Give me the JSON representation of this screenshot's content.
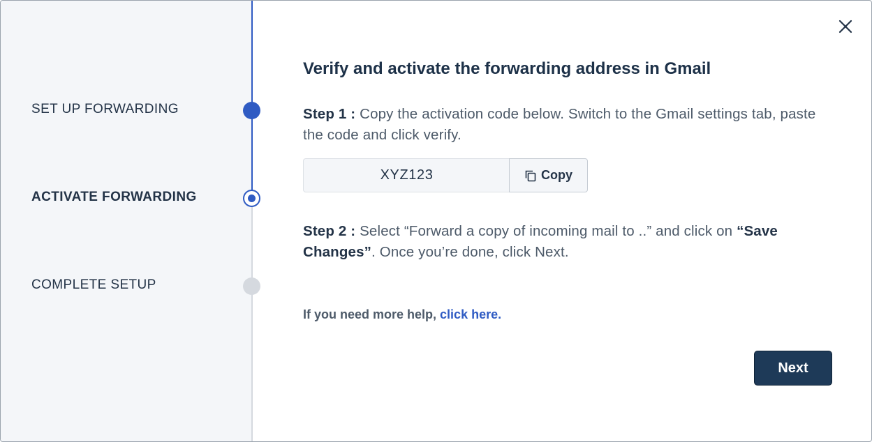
{
  "colors": {
    "accent": "#2f5bc3",
    "sidebar_bg": "#f4f6f9",
    "primary_button": "#1e3a58",
    "inactive_step": "#d5d9df",
    "heading_text": "#1d3148"
  },
  "steps": [
    {
      "label": "SET UP FORWARDING",
      "status": "completed"
    },
    {
      "label": "ACTIVATE FORWARDING",
      "status": "current"
    },
    {
      "label": "COMPLETE SETUP",
      "status": "pending"
    }
  ],
  "dialog": {
    "title": "Verify and activate the forwarding address in Gmail",
    "close_icon": "close-icon"
  },
  "step1": {
    "prefix": "Step 1 :",
    "text": "Copy the activation code below. Switch to the Gmail settings tab, paste the code and click verify."
  },
  "activation": {
    "code": "XYZ123",
    "copy_label": "Copy",
    "copy_icon": "copy-icon"
  },
  "step2": {
    "prefix": "Step 2 :",
    "text_before": "Select “Forward a copy of incoming mail to ..” and click on",
    "bold_text": "“Save Changes”",
    "text_after": ". Once you’re done, click Next."
  },
  "help": {
    "text": "If you need more help,",
    "link_text": "click here."
  },
  "footer": {
    "next_label": "Next"
  }
}
